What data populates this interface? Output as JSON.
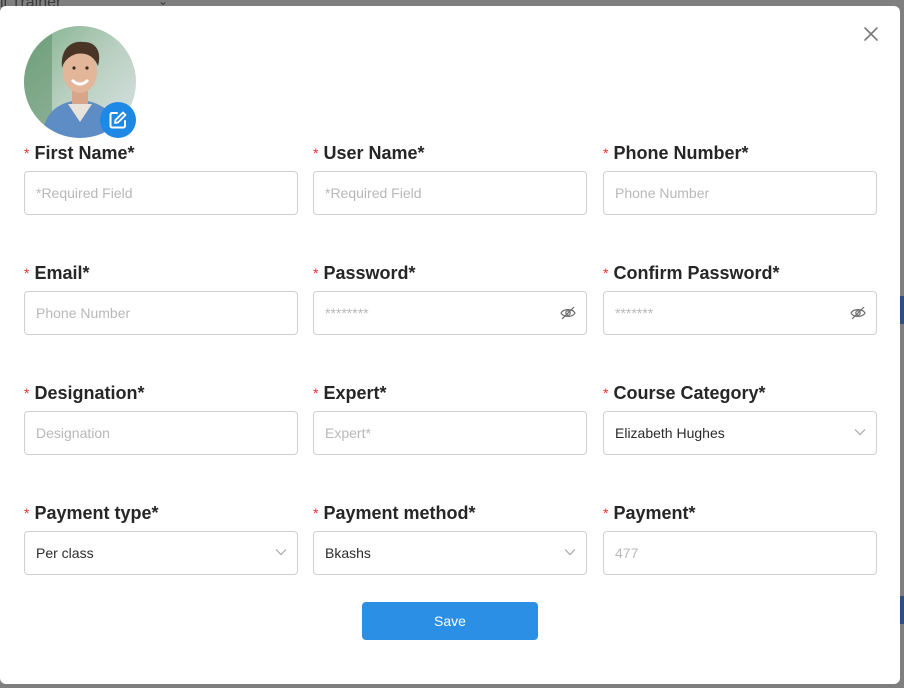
{
  "background": {
    "title": "ll Trainer",
    "colors": {
      "overlay": "#7f7f7f",
      "strip": "#2b4f80"
    }
  },
  "modal": {
    "close_icon": "close-icon",
    "avatar": {
      "edit_icon": "edit-icon",
      "edit_color": "#1e88e5"
    },
    "required_marker": "*",
    "colors": {
      "required": "#e5322d",
      "accent": "#2b8fe6"
    },
    "fields": {
      "first_name": {
        "label": "First Name*",
        "placeholder": "*Required Field"
      },
      "user_name": {
        "label": "User Name*",
        "placeholder": "*Required Field"
      },
      "phone_number": {
        "label": "Phone Number*",
        "placeholder": "Phone Number"
      },
      "email": {
        "label": "Email*",
        "placeholder": "Phone Number"
      },
      "password": {
        "label": "Password*",
        "placeholder": "********",
        "icon": "eye-slash-icon"
      },
      "confirm_password": {
        "label": "Confirm Password*",
        "placeholder": "*******",
        "icon": "eye-slash-icon"
      },
      "designation": {
        "label": "Designation*",
        "placeholder": "Designation"
      },
      "expert": {
        "label": "Expert*",
        "placeholder": "Expert*"
      },
      "course_category": {
        "label": "Course Category*",
        "value": "Elizabeth Hughes",
        "icon": "chevron-down-icon"
      },
      "payment_type": {
        "label": "Payment type*",
        "value": "Per class",
        "icon": "chevron-down-icon"
      },
      "payment_method": {
        "label": "Payment method*",
        "value": "Bkashs",
        "icon": "chevron-down-icon"
      },
      "payment": {
        "label": "Payment*",
        "placeholder": "477"
      }
    },
    "save_label": "Save"
  }
}
